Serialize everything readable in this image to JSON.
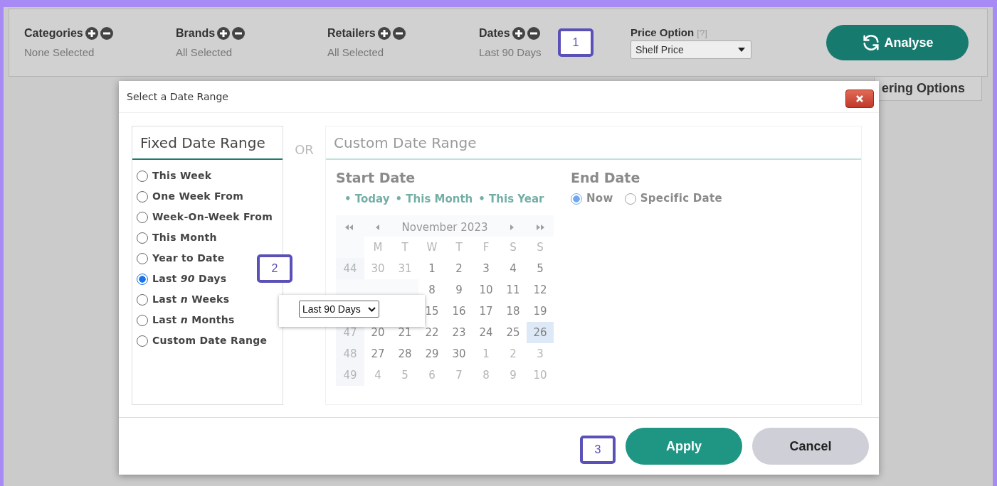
{
  "filters": [
    {
      "label": "Categories",
      "value": "None Selected"
    },
    {
      "label": "Brands",
      "value": "All Selected"
    },
    {
      "label": "Retailers",
      "value": "All Selected"
    },
    {
      "label": "Dates",
      "value": "Last 90 Days"
    }
  ],
  "callouts": [
    "1",
    "2",
    "3"
  ],
  "price_option": {
    "label": "Price Option",
    "help": "[?]",
    "value": "Shelf Price"
  },
  "analyse_button": "Analyse",
  "side_tab": "ering Options",
  "dialog": {
    "title": "Select a Date Range",
    "fixed": {
      "title": "Fixed Date Range",
      "options": [
        {
          "label": "This Week",
          "selected": false
        },
        {
          "label": "One Week From",
          "selected": false
        },
        {
          "label": "Week-On-Week From",
          "selected": false
        },
        {
          "label": "This Month",
          "selected": false
        },
        {
          "label": "Year to Date",
          "selected": false
        },
        {
          "label": "Last *90* Days",
          "selected": true
        },
        {
          "label": "Last *n* Weeks",
          "selected": false
        },
        {
          "label": "Last *n* Months",
          "selected": false
        },
        {
          "label": "Custom Date Range",
          "selected": false
        }
      ]
    },
    "separator": "OR",
    "custom": {
      "title": "Custom Date Range",
      "disabled": true,
      "start": {
        "title": "Start Date",
        "shortcuts": [
          "• Today",
          "• This Month",
          "• This Year"
        ],
        "calendar": {
          "month": "November 2023",
          "weekdays": [
            "M",
            "T",
            "W",
            "T",
            "F",
            "S",
            "S"
          ],
          "rows": [
            {
              "week": "44",
              "days": [
                {
                  "label": "30",
                  "muted": true
                },
                {
                  "label": "31",
                  "muted": true
                },
                {
                  "label": "1"
                },
                {
                  "label": "2"
                },
                {
                  "label": "3"
                },
                {
                  "label": "4"
                },
                {
                  "label": "5"
                }
              ]
            },
            {
              "days": [
                {
                  "label": "8"
                },
                {
                  "label": "9"
                },
                {
                  "label": "10"
                },
                {
                  "label": "11"
                },
                {
                  "label": "12"
                }
              ]
            },
            {
              "days": [
                {
                  "label": "15"
                },
                {
                  "label": "16"
                },
                {
                  "label": "17"
                },
                {
                  "label": "18"
                },
                {
                  "label": "19"
                }
              ]
            },
            {
              "week": "47",
              "days": [
                {
                  "label": "20"
                },
                {
                  "label": "21"
                },
                {
                  "label": "22"
                },
                {
                  "label": "23"
                },
                {
                  "label": "24"
                },
                {
                  "label": "25"
                },
                {
                  "label": "26",
                  "selected": true
                }
              ]
            },
            {
              "week": "48",
              "days": [
                {
                  "label": "27"
                },
                {
                  "label": "28"
                },
                {
                  "label": "29"
                },
                {
                  "label": "30"
                },
                {
                  "label": "1",
                  "muted": true
                },
                {
                  "label": "2",
                  "muted": true
                },
                {
                  "label": "3",
                  "muted": true
                }
              ]
            },
            {
              "week": "49",
              "days": [
                {
                  "label": "4",
                  "muted": true
                },
                {
                  "label": "5",
                  "muted": true
                },
                {
                  "label": "6",
                  "muted": true
                },
                {
                  "label": "7",
                  "muted": true
                },
                {
                  "label": "8",
                  "muted": true
                },
                {
                  "label": "9",
                  "muted": true
                },
                {
                  "label": "10",
                  "muted": true
                }
              ]
            }
          ]
        }
      },
      "end": {
        "title": "End Date",
        "options": [
          {
            "label": "Now",
            "selected": true
          },
          {
            "label": "Specific Date",
            "selected": false
          }
        ]
      }
    },
    "popup": {
      "value": "Last 90 Days"
    },
    "buttons": [
      {
        "label": "Apply",
        "kind": "primary"
      },
      {
        "label": "Cancel",
        "kind": "secondary"
      }
    ]
  }
}
